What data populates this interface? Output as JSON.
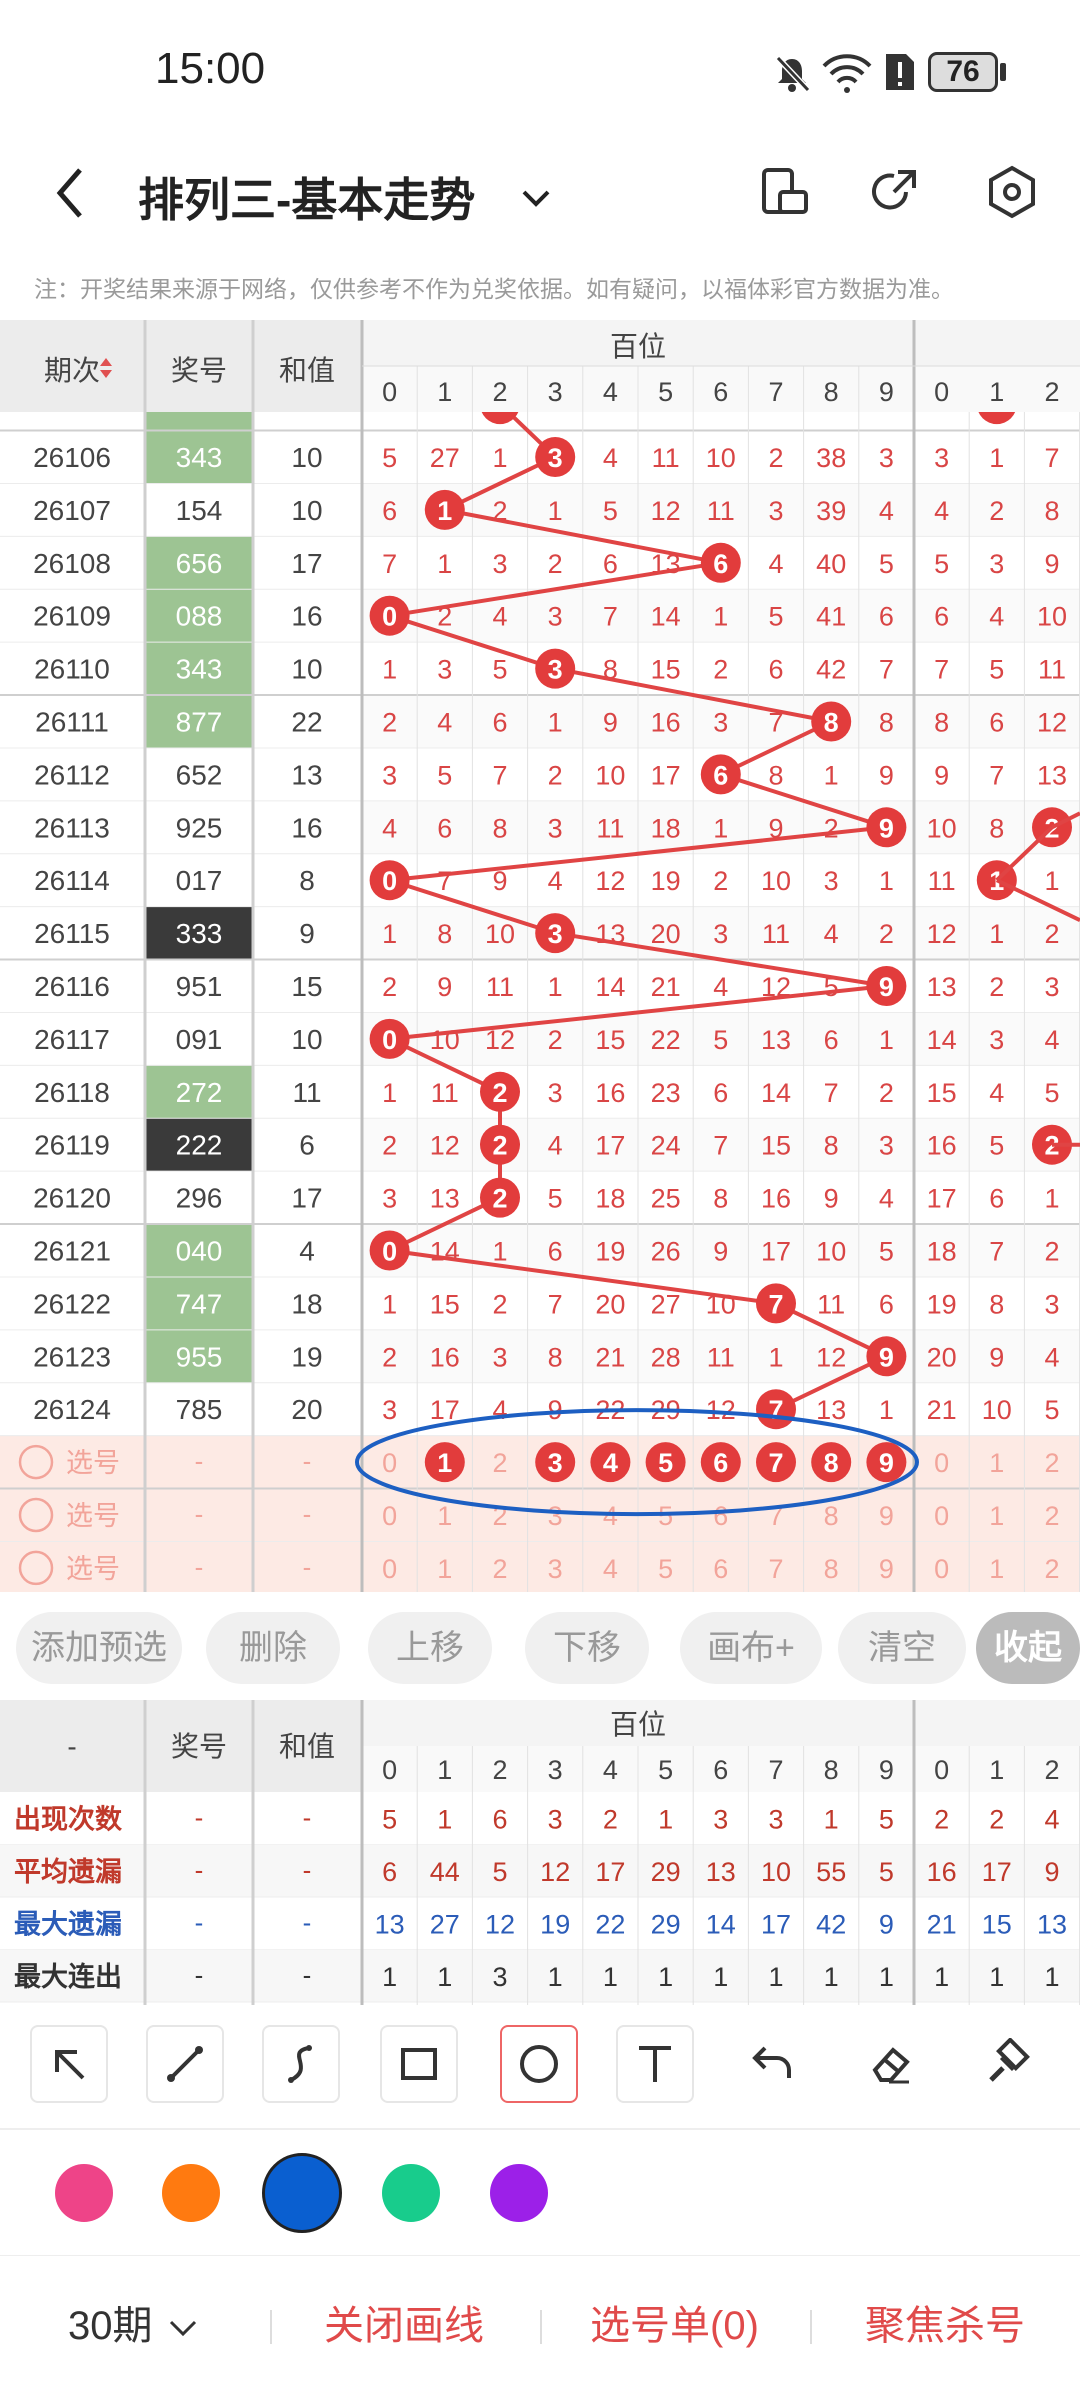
{
  "status": {
    "time": "15:00",
    "battery": "76"
  },
  "header": {
    "title": "排列三-基本走势"
  },
  "note": "注：开奖结果来源于网络，仅供参考不作为兑奖依据。如有疑问，以福体彩官方数据为准。",
  "table": {
    "col_period": "期次",
    "col_prize": "奖号",
    "col_sum": "和值",
    "group_label": "百位",
    "digits": [
      "0",
      "1",
      "2",
      "3",
      "4",
      "5",
      "6",
      "7",
      "8",
      "9"
    ],
    "next_digits": [
      "0",
      "1",
      "2"
    ],
    "rows": [
      {
        "period": "26106",
        "prize": "343",
        "sum": "10",
        "type": "g",
        "hb": 3,
        "cells": [
          "5",
          "27",
          "1",
          "3",
          "4",
          "11",
          "10",
          "2",
          "38",
          "3"
        ],
        "next": [
          "3",
          "1",
          "7"
        ],
        "sh": -1
      },
      {
        "period": "26107",
        "prize": "154",
        "sum": "10",
        "type": "w",
        "hb": 1,
        "cells": [
          "6",
          "1",
          "2",
          "1",
          "5",
          "12",
          "11",
          "3",
          "39",
          "4"
        ],
        "next": [
          "4",
          "2",
          "8"
        ],
        "sh": -1
      },
      {
        "period": "26108",
        "prize": "656",
        "sum": "17",
        "type": "g",
        "hb": 6,
        "cells": [
          "7",
          "1",
          "3",
          "2",
          "6",
          "13",
          "6",
          "4",
          "40",
          "5"
        ],
        "next": [
          "5",
          "3",
          "9"
        ],
        "sh": -1
      },
      {
        "period": "26109",
        "prize": "088",
        "sum": "16",
        "type": "g",
        "hb": 0,
        "cells": [
          "0",
          "2",
          "4",
          "3",
          "7",
          "14",
          "1",
          "5",
          "41",
          "6"
        ],
        "next": [
          "6",
          "4",
          "10"
        ],
        "sh": -1
      },
      {
        "period": "26110",
        "prize": "343",
        "sum": "10",
        "type": "g",
        "hb": 3,
        "cells": [
          "1",
          "3",
          "5",
          "3",
          "8",
          "15",
          "2",
          "6",
          "42",
          "7"
        ],
        "next": [
          "7",
          "5",
          "11"
        ],
        "sh": -1
      },
      {
        "period": "26111",
        "prize": "877",
        "sum": "22",
        "type": "g",
        "hb": 8,
        "cells": [
          "2",
          "4",
          "6",
          "1",
          "9",
          "16",
          "3",
          "7",
          "8",
          "8"
        ],
        "next": [
          "8",
          "6",
          "12"
        ],
        "sh": -1
      },
      {
        "period": "26112",
        "prize": "652",
        "sum": "13",
        "type": "w",
        "hb": 6,
        "cells": [
          "3",
          "5",
          "7",
          "2",
          "10",
          "17",
          "6",
          "8",
          "1",
          "9"
        ],
        "next": [
          "9",
          "7",
          "13"
        ],
        "sh": -1
      },
      {
        "period": "26113",
        "prize": "925",
        "sum": "16",
        "type": "w",
        "hb": 9,
        "cells": [
          "4",
          "6",
          "8",
          "3",
          "11",
          "18",
          "1",
          "9",
          "2",
          "9"
        ],
        "next": [
          "10",
          "8",
          "2"
        ],
        "sh": 2
      },
      {
        "period": "26114",
        "prize": "017",
        "sum": "8",
        "type": "w",
        "hb": 0,
        "cells": [
          "0",
          "7",
          "9",
          "4",
          "12",
          "19",
          "2",
          "10",
          "3",
          "1"
        ],
        "next": [
          "11",
          "1",
          "1"
        ],
        "sh": 1
      },
      {
        "period": "26115",
        "prize": "333",
        "sum": "9",
        "type": "d",
        "hb": 3,
        "cells": [
          "1",
          "8",
          "10",
          "3",
          "13",
          "20",
          "3",
          "11",
          "4",
          "2"
        ],
        "next": [
          "12",
          "1",
          "2"
        ],
        "sh": -1
      },
      {
        "period": "26116",
        "prize": "951",
        "sum": "15",
        "type": "w",
        "hb": 9,
        "cells": [
          "2",
          "9",
          "11",
          "1",
          "14",
          "21",
          "4",
          "12",
          "5",
          "9"
        ],
        "next": [
          "13",
          "2",
          "3"
        ],
        "sh": -1
      },
      {
        "period": "26117",
        "prize": "091",
        "sum": "10",
        "type": "w",
        "hb": 0,
        "cells": [
          "0",
          "10",
          "12",
          "2",
          "15",
          "22",
          "5",
          "13",
          "6",
          "1"
        ],
        "next": [
          "14",
          "3",
          "4"
        ],
        "sh": -1
      },
      {
        "period": "26118",
        "prize": "272",
        "sum": "11",
        "type": "g",
        "hb": 2,
        "cells": [
          "1",
          "11",
          "2",
          "3",
          "16",
          "23",
          "6",
          "14",
          "7",
          "2"
        ],
        "next": [
          "15",
          "4",
          "5"
        ],
        "sh": -1
      },
      {
        "period": "26119",
        "prize": "222",
        "sum": "6",
        "type": "d",
        "hb": 2,
        "cells": [
          "2",
          "12",
          "2",
          "4",
          "17",
          "24",
          "7",
          "15",
          "8",
          "3"
        ],
        "next": [
          "16",
          "5",
          "2"
        ],
        "sh": 2
      },
      {
        "period": "26120",
        "prize": "296",
        "sum": "17",
        "type": "w",
        "hb": 2,
        "cells": [
          "3",
          "13",
          "2",
          "5",
          "18",
          "25",
          "8",
          "16",
          "9",
          "4"
        ],
        "next": [
          "17",
          "6",
          "1"
        ],
        "sh": -1
      },
      {
        "period": "26121",
        "prize": "040",
        "sum": "4",
        "type": "g",
        "hb": 0,
        "cells": [
          "0",
          "14",
          "1",
          "6",
          "19",
          "26",
          "9",
          "17",
          "10",
          "5"
        ],
        "next": [
          "18",
          "7",
          "2"
        ],
        "sh": -1
      },
      {
        "period": "26122",
        "prize": "747",
        "sum": "18",
        "type": "g",
        "hb": 7,
        "cells": [
          "1",
          "15",
          "2",
          "7",
          "20",
          "27",
          "10",
          "7",
          "11",
          "6"
        ],
        "next": [
          "19",
          "8",
          "3"
        ],
        "sh": -1
      },
      {
        "period": "26123",
        "prize": "955",
        "sum": "19",
        "type": "g",
        "hb": 9,
        "cells": [
          "2",
          "16",
          "3",
          "8",
          "21",
          "28",
          "11",
          "1",
          "12",
          "9"
        ],
        "next": [
          "20",
          "9",
          "4"
        ],
        "sh": -1
      },
      {
        "period": "26124",
        "prize": "785",
        "sum": "20",
        "type": "w",
        "hb": 7,
        "cells": [
          "3",
          "17",
          "4",
          "9",
          "22",
          "29",
          "12",
          "7",
          "13",
          "1"
        ],
        "next": [
          "21",
          "10",
          "5"
        ],
        "sh": -1
      }
    ],
    "select_label": "选号",
    "dash": "-",
    "select_rows": [
      [
        1,
        3,
        4,
        5,
        6,
        7,
        8,
        9
      ],
      [],
      []
    ]
  },
  "actions": [
    "添加预选",
    "删除",
    "上移",
    "下移",
    "画布+",
    "清空",
    "收起"
  ],
  "stats": {
    "col_dash": "-",
    "col_prize": "奖号",
    "col_sum": "和值",
    "group_label": "百位",
    "rows": [
      {
        "label": "出现次数",
        "color": "#c0392b",
        "vals": [
          "5",
          "1",
          "6",
          "3",
          "2",
          "1",
          "3",
          "3",
          "1",
          "5"
        ],
        "next": [
          "2",
          "2",
          "4"
        ]
      },
      {
        "label": "平均遗漏",
        "color": "#c0392b",
        "vals": [
          "6",
          "44",
          "5",
          "12",
          "17",
          "29",
          "13",
          "10",
          "55",
          "5"
        ],
        "next": [
          "16",
          "17",
          "9"
        ]
      },
      {
        "label": "最大遗漏",
        "color": "#2b5cb8",
        "vals": [
          "13",
          "27",
          "12",
          "19",
          "22",
          "29",
          "14",
          "17",
          "42",
          "9"
        ],
        "next": [
          "21",
          "15",
          "13"
        ]
      },
      {
        "label": "最大连出",
        "color": "#333333",
        "vals": [
          "1",
          "1",
          "3",
          "1",
          "1",
          "1",
          "1",
          "1",
          "1",
          "1"
        ],
        "next": [
          "1",
          "1",
          "1"
        ]
      }
    ]
  },
  "tools": [
    "arrow-tool",
    "line-tool",
    "curve-tool",
    "rect-tool",
    "circle-tool",
    "text-tool",
    "undo-tool",
    "eraser-tool",
    "brush-tool"
  ],
  "swatches": [
    "#ee4488",
    "#ff7a10",
    "#0a5fd0",
    "#18cc8c",
    "#9c20e8"
  ],
  "bottom": {
    "period": "30期",
    "close_lines": "关闭画线",
    "pick_list": "选号单(0)",
    "focus_kill": "聚焦杀号"
  }
}
